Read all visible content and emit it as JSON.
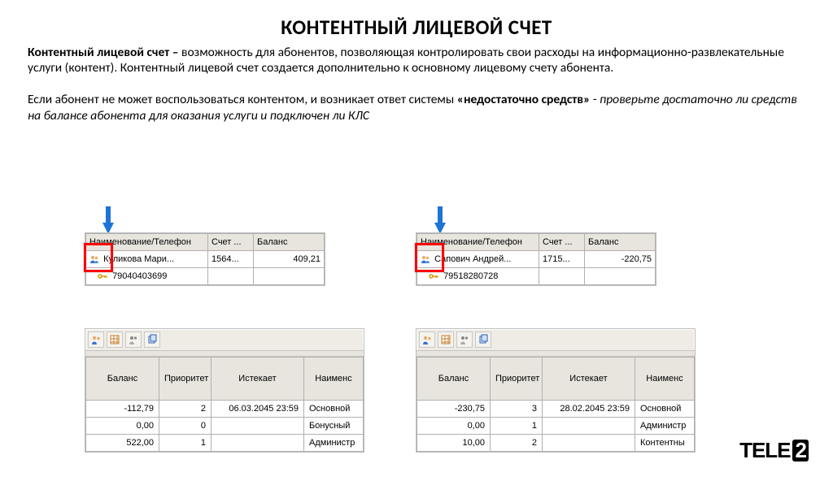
{
  "title": "КОНТЕНТНЫЙ ЛИЦЕВОЙ СЧЕТ",
  "intro": {
    "lead": "Контентный лицевой счет –",
    "body1": " возможность для абонентов, позволяющая контролировать свои расходы на информационно-развлекательные услуги (контент). Контентный лицевой счет создается дополнительно к основному лицевому счету абонента.",
    "body2a": "Если абонент не может воспользоваться контентом, и возникает ответ системы ",
    "body2b": "«недостаточно средств»",
    "body2c": " - ",
    "body2d": "проверьте достаточно ли средств на балансе абонента для оказания услуги и подключен ли КЛС"
  },
  "subs": {
    "hdr": {
      "name": "Наименование/Телефон",
      "acct": "Счет ...",
      "bal": "Баланс"
    },
    "a": {
      "name": "Куликова Мари...",
      "acct": "1564...",
      "bal": "409,21",
      "phone": "79040403699"
    },
    "b": {
      "name": "Сапович Андрей...",
      "acct": "1715...",
      "bal": "-220,75",
      "phone": "79518280728"
    }
  },
  "balhdr": {
    "c1": "Баланс",
    "c2": "Приоритет",
    "c3": "Истекает",
    "c4": "Наименс"
  },
  "balA": {
    "r1": {
      "bal": "-112,79",
      "pr": "2",
      "exp": "06.03.2045 23:59",
      "name": "Основной"
    },
    "r2": {
      "bal": "0,00",
      "pr": "0",
      "exp": "",
      "name": "Бонусный"
    },
    "r3": {
      "bal": "522,00",
      "pr": "1",
      "exp": "",
      "name": "Администр"
    }
  },
  "balB": {
    "r1": {
      "bal": "-230,75",
      "pr": "3",
      "exp": "28.02.2045 23:59",
      "name": "Основной"
    },
    "r2": {
      "bal": "0,00",
      "pr": "1",
      "exp": "",
      "name": "Администр"
    },
    "r3": {
      "bal": "10,00",
      "pr": "2",
      "exp": "",
      "name": "Контентны"
    }
  },
  "logo": {
    "t": "TELE",
    "n": "2"
  }
}
